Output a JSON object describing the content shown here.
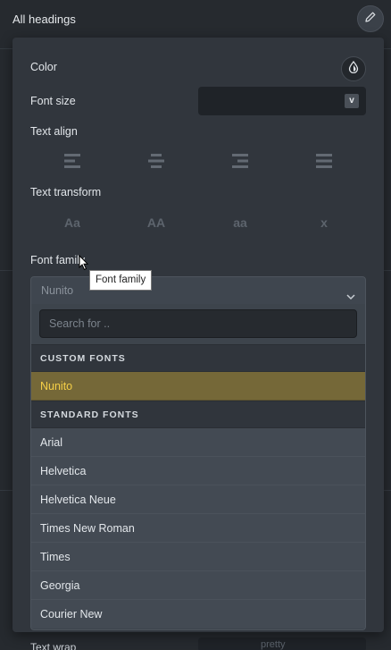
{
  "header": {
    "title": "All headings"
  },
  "panel": {
    "color_label": "Color",
    "font_size_label": "Font size",
    "font_size_value": "",
    "font_size_button": "v",
    "text_align_label": "Text align",
    "text_align_options": [
      "align-left-icon",
      "align-center-icon",
      "align-right-icon",
      "align-justify-icon"
    ],
    "text_transform_label": "Text transform",
    "text_transform_options": [
      "Aa",
      "AA",
      "aa",
      "x"
    ],
    "font_family_label": "Font family",
    "font_family_value": "Nunito",
    "tooltip": "Font family"
  },
  "dropdown": {
    "search_placeholder": "Search for ..",
    "custom_header": "CUSTOM FONTS",
    "custom_fonts": [
      "Nunito"
    ],
    "standard_header": "STANDARD FONTS",
    "standard_fonts": [
      "Arial",
      "Helvetica",
      "Helvetica Neue",
      "Times New Roman",
      "Times",
      "Georgia",
      "Courier New"
    ]
  },
  "background": {
    "bottom_label": "Text wrap",
    "bottom_select": "pretty"
  },
  "colors": {
    "accent": "#f5cf47",
    "selected_bg": "#756838",
    "panel_bg": "#31363d"
  }
}
